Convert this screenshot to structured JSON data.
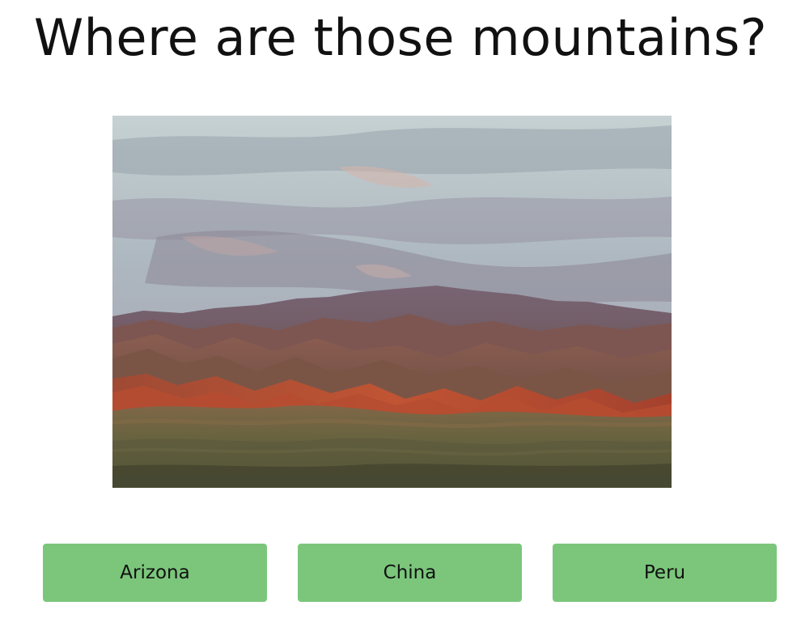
{
  "quiz": {
    "question": "Where are those mountains?",
    "image": {
      "subject": "red desert mountain range at sunset"
    },
    "answers": [
      {
        "label": "Arizona"
      },
      {
        "label": "China"
      },
      {
        "label": "Peru"
      }
    ]
  },
  "colors": {
    "background": "#ffffff",
    "title_text": "#111111",
    "answer_button": "#7bc67b",
    "answer_text": "#111111"
  }
}
